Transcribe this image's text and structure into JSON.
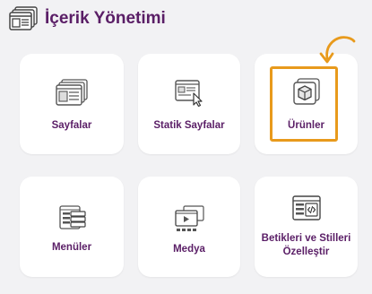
{
  "header": {
    "title": "İçerik Yönetimi",
    "icon": "layout-windows-icon"
  },
  "cards": [
    {
      "label": "Sayfalar",
      "icon": "pages-icon"
    },
    {
      "label": "Statik Sayfalar",
      "icon": "static-page-cursor-icon"
    },
    {
      "label": "Ürünler",
      "icon": "product-box-icon"
    },
    {
      "label": "Menüler",
      "icon": "menu-list-icon"
    },
    {
      "label": "Medya",
      "icon": "media-icon"
    },
    {
      "label": "Betikleri ve Stilleri Özelleştir",
      "icon": "code-window-icon"
    }
  ],
  "colors": {
    "title": "#5a1e66",
    "highlight": "#e89a1c",
    "background": "#f2f2f4",
    "card": "#ffffff"
  }
}
